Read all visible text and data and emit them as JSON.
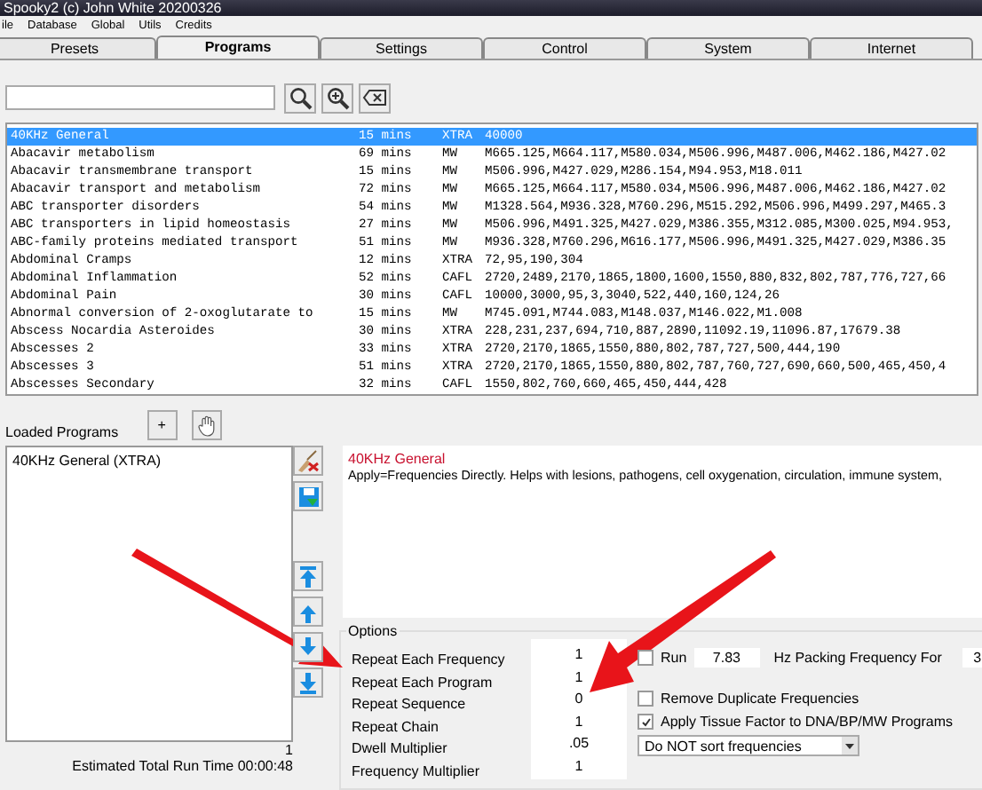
{
  "window": {
    "title": "Spooky2 (c) John White 20200326"
  },
  "menu": [
    "ile",
    "Database",
    "Global",
    "Utils",
    "Credits"
  ],
  "tabs": [
    {
      "label": "Presets",
      "selected": false
    },
    {
      "label": "Programs",
      "selected": true
    },
    {
      "label": "Settings",
      "selected": false
    },
    {
      "label": "Control",
      "selected": false
    },
    {
      "label": "System",
      "selected": false
    },
    {
      "label": "Internet",
      "selected": false
    }
  ],
  "programs": [
    {
      "name": "40KHz General",
      "duration": "15 mins",
      "type": "XTRA",
      "frequencies": "40000",
      "selected": true
    },
    {
      "name": "Abacavir metabolism",
      "duration": "69 mins",
      "type": "MW",
      "frequencies": "M665.125,M664.117,M580.034,M506.996,M487.006,M462.186,M427.02",
      "selected": false
    },
    {
      "name": "Abacavir transmembrane transport",
      "duration": "15 mins",
      "type": "MW",
      "frequencies": "M506.996,M427.029,M286.154,M94.953,M18.011",
      "selected": false
    },
    {
      "name": "Abacavir transport and metabolism",
      "duration": "72 mins",
      "type": "MW",
      "frequencies": "M665.125,M664.117,M580.034,M506.996,M487.006,M462.186,M427.02",
      "selected": false
    },
    {
      "name": "ABC transporter disorders",
      "duration": "54 mins",
      "type": "MW",
      "frequencies": "M1328.564,M936.328,M760.296,M515.292,M506.996,M499.297,M465.3",
      "selected": false
    },
    {
      "name": "ABC transporters in lipid homeostasis",
      "duration": "27 mins",
      "type": "MW",
      "frequencies": "M506.996,M491.325,M427.029,M386.355,M312.085,M300.025,M94.953,",
      "selected": false
    },
    {
      "name": "ABC-family proteins mediated transport",
      "duration": "51 mins",
      "type": "MW",
      "frequencies": "M936.328,M760.296,M616.177,M506.996,M491.325,M427.029,M386.35",
      "selected": false
    },
    {
      "name": "Abdominal Cramps",
      "duration": "12 mins",
      "type": "XTRA",
      "frequencies": "72,95,190,304",
      "selected": false
    },
    {
      "name": "Abdominal Inflammation",
      "duration": "52 mins",
      "type": "CAFL",
      "frequencies": "2720,2489,2170,1865,1800,1600,1550,880,832,802,787,776,727,66",
      "selected": false
    },
    {
      "name": "Abdominal Pain",
      "duration": "30 mins",
      "type": "CAFL",
      "frequencies": "10000,3000,95,3,3040,522,440,160,124,26",
      "selected": false
    },
    {
      "name": "Abnormal conversion of 2-oxoglutarate to",
      "duration": "15 mins",
      "type": "MW",
      "frequencies": "M745.091,M744.083,M148.037,M146.022,M1.008",
      "selected": false
    },
    {
      "name": "Abscess Nocardia Asteroides",
      "duration": "30 mins",
      "type": "XTRA",
      "frequencies": "228,231,237,694,710,887,2890,11092.19,11096.87,17679.38",
      "selected": false
    },
    {
      "name": "Abscesses 2",
      "duration": "33 mins",
      "type": "XTRA",
      "frequencies": "2720,2170,1865,1550,880,802,787,727,500,444,190",
      "selected": false
    },
    {
      "name": "Abscesses 3",
      "duration": "51 mins",
      "type": "XTRA",
      "frequencies": "2720,2170,1865,1550,880,802,787,760,727,690,660,500,465,450,4",
      "selected": false
    },
    {
      "name": "Abscesses Secondary",
      "duration": "32 mins",
      "type": "CAFL",
      "frequencies": "1550,802,760,660,465,450,444,428",
      "selected": false
    }
  ],
  "loaded": {
    "label": "Loaded Programs",
    "add_button": "+",
    "items": [
      "40KHz General (XTRA)"
    ]
  },
  "description": {
    "title": "40KHz General",
    "text": "Apply=Frequencies Directly. Helps with lesions, pathogens, cell oxygenation, circulation, immune system,"
  },
  "count": "1",
  "estimate": "Estimated Total Run Time 00:00:48",
  "options": {
    "label": "Options",
    "rows": [
      {
        "label": "Repeat Each Frequency",
        "value": "1"
      },
      {
        "label": "Repeat Each Program",
        "value": "1"
      },
      {
        "label": "Repeat Sequence",
        "value": "0"
      },
      {
        "label": "Repeat Chain",
        "value": "1"
      },
      {
        "label": "Dwell Multiplier",
        "value": ".05"
      },
      {
        "label": "Frequency Multiplier",
        "value": "1"
      }
    ],
    "run": {
      "label": "Run",
      "checked": false,
      "value": "7.83",
      "suffix": "Hz Packing Frequency For",
      "value2": "3"
    },
    "checkboxes": [
      {
        "label": "Remove Duplicate Frequencies",
        "checked": false
      },
      {
        "label": "Apply Tissue Factor to DNA/BP/MW Programs",
        "checked": true
      }
    ],
    "sort": "Do NOT sort frequencies"
  }
}
